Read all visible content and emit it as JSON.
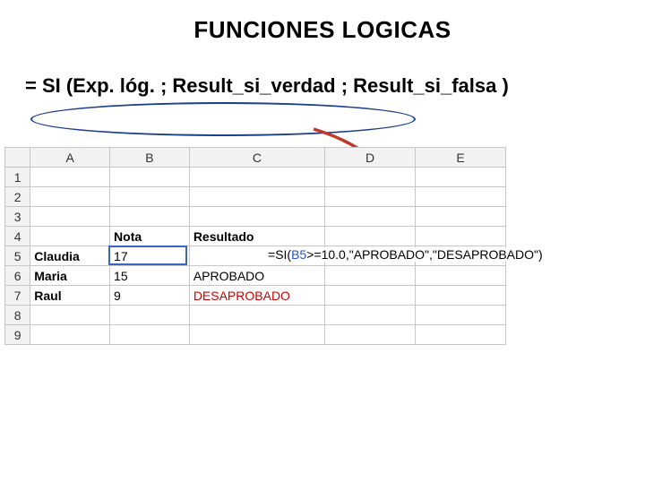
{
  "title": "FUNCIONES LOGICAS",
  "syntax": "= SI (Exp. lóg. ; Result_si_verdad ; Result_si_falsa )",
  "columns": {
    "A": "A",
    "B": "B",
    "C": "C",
    "D": "D",
    "E": "E"
  },
  "rowlabels": {
    "r1": "1",
    "r2": "2",
    "r3": "3",
    "r4": "4",
    "r5": "5",
    "r6": "6",
    "r7": "7",
    "r8": "8",
    "r9": "9"
  },
  "headers": {
    "nota": "Nota",
    "resultado": "Resultado"
  },
  "rows": {
    "r5": {
      "name": "Claudia",
      "nota": "17",
      "resultado_formula": "=SI(B5>=10.0,\"APROBADO\",\"DESAPROBADO\")"
    },
    "r6": {
      "name": "Maria",
      "nota": "15",
      "resultado": "APROBADO"
    },
    "r7": {
      "name": "Raul",
      "nota": "9",
      "resultado": "DESAPROBADO"
    }
  },
  "formula_parts": {
    "eq": "=",
    "fn": "SI",
    "open": "(",
    "ref": "B5",
    "cmp": ">=10.0,",
    "s1": "\"APROBADO\"",
    "comma": ",",
    "s2": "\"DESAPROBADO\"",
    "close": ")"
  }
}
